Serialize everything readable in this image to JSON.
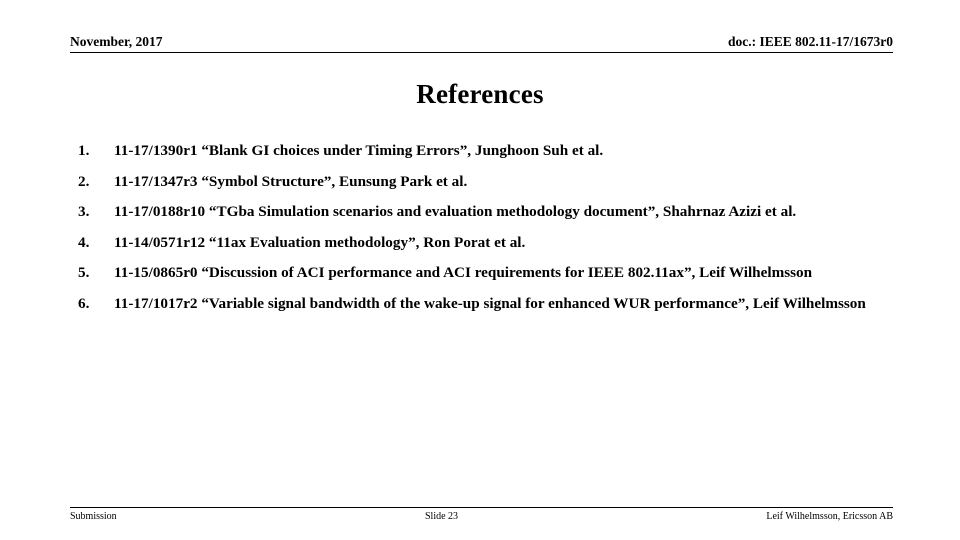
{
  "header": {
    "date": "November, 2017",
    "doc_id": "doc.: IEEE 802.11-17/1673r0"
  },
  "title": "References",
  "references": [
    {
      "number": "1.",
      "text": "11-17/1390r1 “Blank GI choices under Timing Errors”, Junghoon Suh et al."
    },
    {
      "number": "2.",
      "text": "11-17/1347r3 “Symbol Structure”, Eunsung Park et al."
    },
    {
      "number": "3.",
      "text": "11-17/0188r10 “TGba Simulation scenarios and evaluation methodology document”, Shahrnaz Azizi et al."
    },
    {
      "number": "4.",
      "text": "11-14/0571r12 “11ax Evaluation methodology”, Ron Porat et al."
    },
    {
      "number": "5.",
      "text": "11-15/0865r0 “Discussion of ACI performance and ACI requirements for IEEE 802.11ax”, Leif Wilhelmsson"
    },
    {
      "number": "6.",
      "text": "11-17/1017r2 “Variable signal bandwidth of the wake-up signal for enhanced WUR performance”, Leif Wilhelmsson"
    }
  ],
  "footer": {
    "left": "Submission",
    "center": "Slide 23",
    "right": "Leif Wilhelmsson, Ericsson AB"
  }
}
